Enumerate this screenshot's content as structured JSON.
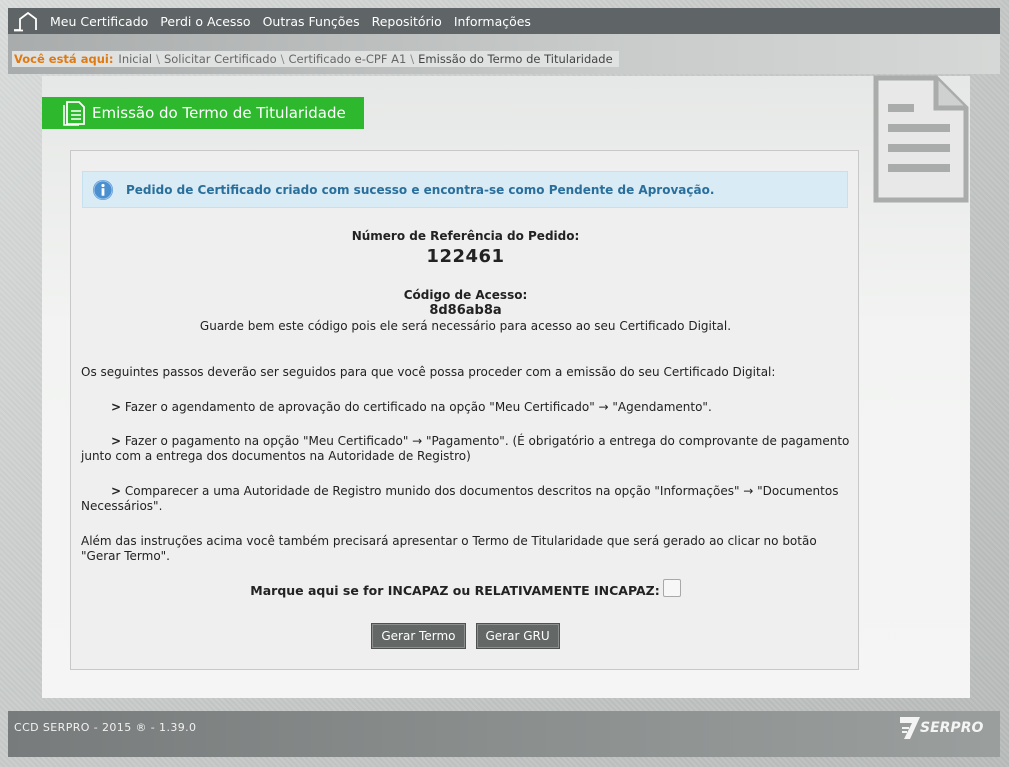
{
  "nav": {
    "items": [
      {
        "label": "Meu Certificado"
      },
      {
        "label": "Perdi o Acesso"
      },
      {
        "label": "Outras Funções"
      },
      {
        "label": "Repositório"
      },
      {
        "label": "Informações"
      }
    ]
  },
  "breadcrumb": {
    "here_label": "Você está aqui:",
    "items": [
      {
        "label": "Inicial"
      },
      {
        "label": "Solicitar Certificado"
      },
      {
        "label": "Certificado e-CPF A1"
      },
      {
        "label": "Emissão do Termo de Titularidade"
      }
    ]
  },
  "page": {
    "title": "Emissão do Termo de Titularidade"
  },
  "alert": {
    "text": "Pedido de Certificado criado com sucesso e encontra-se como Pendente de Aprovação."
  },
  "reference": {
    "label": "Número de Referência do Pedido:",
    "value": "122461"
  },
  "access_code": {
    "label": "Código de Acesso:",
    "value": "8d86ab8a",
    "note": "Guarde bem este código pois ele será necessário para acesso ao seu Certificado Digital."
  },
  "instructions": {
    "intro": "Os seguintes passos deverão ser seguidos para que você possa proceder com a emissão do seu Certificado Digital:",
    "marker": ">",
    "steps": [
      "Fazer o agendamento de aprovação do certificado na opção \"Meu Certificado\" → \"Agendamento\".",
      "Fazer o pagamento na opção \"Meu Certificado\" → \"Pagamento\". (É obrigatório a entrega do comprovante de pagamento junto com a entrega dos documentos na Autoridade de Registro)",
      "Comparecer a uma Autoridade de Registro munido dos documentos descritos na opção \"Informações\" → \"Documentos Necessários\"."
    ],
    "extra": "Além das instruções acima você também precisará apresentar o Termo de Titularidade que será gerado ao clicar no botão \"Gerar Termo\"."
  },
  "incapaz": {
    "label": "Marque aqui se for INCAPAZ ou RELATIVAMENTE INCAPAZ:",
    "checked": false
  },
  "buttons": {
    "gerar_termo": "Gerar Termo",
    "gerar_gru": "Gerar GRU"
  },
  "footer": {
    "text": "CCD SERPRO - 2015 ® - 1.39.0",
    "logo_text": "SERPRO"
  },
  "icons": {
    "home": "home-icon",
    "title": "document-icon",
    "alert": "info-icon",
    "deco": "document-icon"
  },
  "colors": {
    "accent_green": "#2db82d",
    "breadcrumb_here": "#e07a10",
    "alert_text": "#2a6f9c",
    "alert_bg": "#d9ebf5",
    "nav_bg": "#5f6466"
  }
}
